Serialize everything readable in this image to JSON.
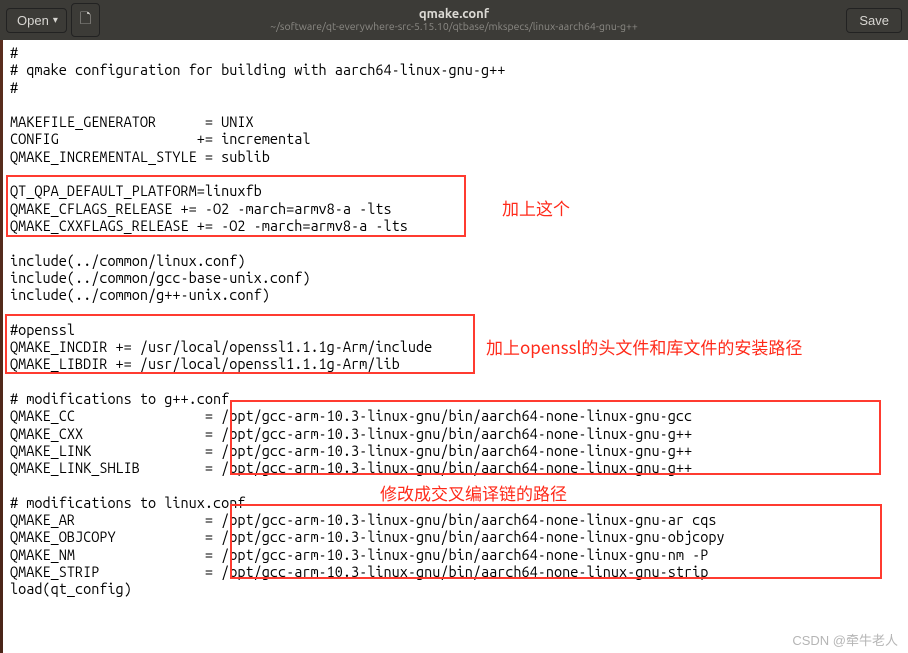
{
  "titlebar": {
    "open_label": "Open",
    "save_label": "Save",
    "filename": "qmake.conf",
    "filepath": "~/software/qt-everywhere-src-5.15.10/qtbase/mkspecs/linux-aarch64-gnu-g++"
  },
  "editor_text": "#\n# qmake configuration for building with aarch64-linux-gnu-g++\n#\n\nMAKEFILE_GENERATOR      = UNIX\nCONFIG                 += incremental\nQMAKE_INCREMENTAL_STYLE = sublib\n\nQT_QPA_DEFAULT_PLATFORM=linuxfb\nQMAKE_CFLAGS_RELEASE += -O2 -march=armv8-a -lts\nQMAKE_CXXFLAGS_RELEASE += -O2 -march=armv8-a -lts\n\ninclude(../common/linux.conf)\ninclude(../common/gcc-base-unix.conf)\ninclude(../common/g++-unix.conf)\n\n#openssl\nQMAKE_INCDIR += /usr/local/openssl1.1.1g-Arm/include\nQMAKE_LIBDIR += /usr/local/openssl1.1.1g-Arm/lib\n\n# modifications to g++.conf\nQMAKE_CC                = /opt/gcc-arm-10.3-linux-gnu/bin/aarch64-none-linux-gnu-gcc\nQMAKE_CXX               = /opt/gcc-arm-10.3-linux-gnu/bin/aarch64-none-linux-gnu-g++\nQMAKE_LINK              = /opt/gcc-arm-10.3-linux-gnu/bin/aarch64-none-linux-gnu-g++\nQMAKE_LINK_SHLIB        = /opt/gcc-arm-10.3-linux-gnu/bin/aarch64-none-linux-gnu-g++\n\n# modifications to linux.conf\nQMAKE_AR                = /opt/gcc-arm-10.3-linux-gnu/bin/aarch64-none-linux-gnu-ar cqs\nQMAKE_OBJCOPY           = /opt/gcc-arm-10.3-linux-gnu/bin/aarch64-none-linux-gnu-objcopy\nQMAKE_NM                = /opt/gcc-arm-10.3-linux-gnu/bin/aarch64-none-linux-gnu-nm -P\nQMAKE_STRIP             = /opt/gcc-arm-10.3-linux-gnu/bin/aarch64-none-linux-gnu-strip\nload(qt_config)",
  "annotations": {
    "label1": "加上这个",
    "label2": "加上openssl的头文件和库文件的安装路径",
    "label3": "修改成交叉编译链的路径"
  },
  "watermark": "CSDN @牵牛老人"
}
